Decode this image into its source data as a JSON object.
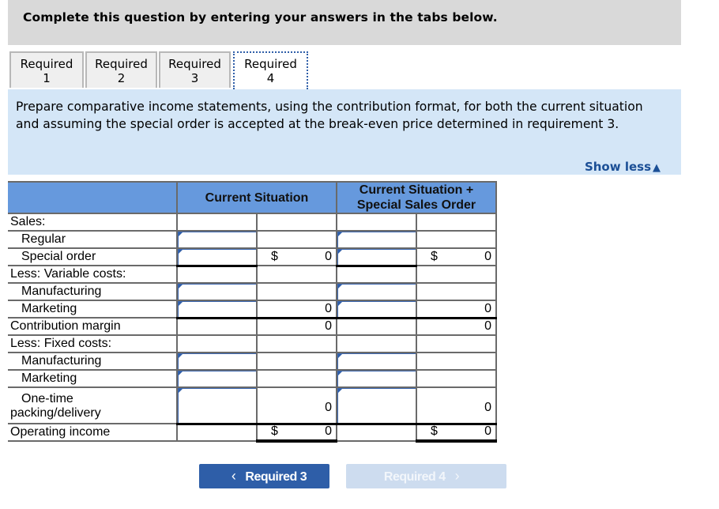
{
  "instruction": "Complete this question by entering your answers in the tabs below.",
  "tabs": [
    {
      "line1": "Required",
      "line2": "1",
      "active": false
    },
    {
      "line1": "Required",
      "line2": "2",
      "active": false
    },
    {
      "line1": "Required",
      "line2": "3",
      "active": false
    },
    {
      "line1": "Required",
      "line2": "4",
      "active": true
    }
  ],
  "prompt": {
    "text": "Prepare comparative income statements, using the contribution format, for both the current situation and assuming the special order is accepted at the break-even price determined in requirement 3.",
    "show_less_label": "Show less",
    "show_less_icon": "triangle-up-icon"
  },
  "table": {
    "headers": [
      "Current Situation",
      "Current Situation + Special Sales Order"
    ],
    "rows": [
      {
        "label": "Sales:",
        "cs_total": "",
        "cs_dollar": "",
        "ss_total": "",
        "ss_dollar": ""
      },
      {
        "label": "Regular",
        "cs_total": "",
        "cs_dollar": "",
        "ss_total": "",
        "ss_dollar": ""
      },
      {
        "label": "Special order",
        "cs_total": "0",
        "cs_dollar": "$",
        "ss_total": "0",
        "ss_dollar": "$"
      },
      {
        "label": "Less: Variable costs:",
        "cs_total": "",
        "cs_dollar": "",
        "ss_total": "",
        "ss_dollar": ""
      },
      {
        "label": "Manufacturing",
        "cs_total": "",
        "cs_dollar": "",
        "ss_total": "",
        "ss_dollar": ""
      },
      {
        "label": "Marketing",
        "cs_total": "0",
        "cs_dollar": "",
        "ss_total": "0",
        "ss_dollar": ""
      },
      {
        "label": "Contribution margin",
        "cs_total": "0",
        "cs_dollar": "",
        "ss_total": "0",
        "ss_dollar": ""
      },
      {
        "label": "Less: Fixed costs:",
        "cs_total": "",
        "cs_dollar": "",
        "ss_total": "",
        "ss_dollar": ""
      },
      {
        "label": "Manufacturing",
        "cs_total": "",
        "cs_dollar": "",
        "ss_total": "",
        "ss_dollar": ""
      },
      {
        "label": "Marketing",
        "cs_total": "",
        "cs_dollar": "",
        "ss_total": "",
        "ss_dollar": ""
      },
      {
        "label_line1": "One-time",
        "label_line2": "packing/delivery",
        "cs_total": "0",
        "cs_dollar": "",
        "ss_total": "0",
        "ss_dollar": ""
      },
      {
        "label": "Operating income",
        "cs_total": "0",
        "cs_dollar": "$",
        "ss_total": "0",
        "ss_dollar": "$"
      }
    ]
  },
  "nav": {
    "prev_label": "Required 3",
    "prev_icon": "chevron-left-icon",
    "next_label": "Required 4",
    "next_icon": "chevron-right-icon"
  },
  "colors": {
    "header_bg": "#6699dd",
    "prompt_bg": "#d4e6f7",
    "accent": "#2e5ea8",
    "disabled_button": "#cddcef"
  }
}
